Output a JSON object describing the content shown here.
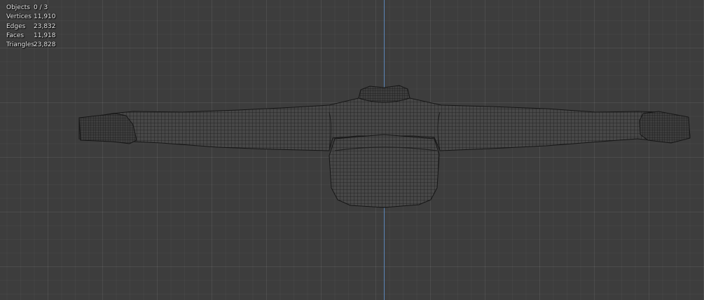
{
  "overlay_stats": [
    {
      "label": "Objects",
      "value": "0 / 3"
    },
    {
      "label": "Vertices",
      "value": "11,910"
    },
    {
      "label": "Edges",
      "value": "23,832"
    },
    {
      "label": "Faces",
      "value": "11,918"
    },
    {
      "label": "Triangles",
      "value": "23,828"
    }
  ],
  "colors": {
    "background": "#3d3d3d",
    "grid_line": "#4a4a4a",
    "z_axis": "#5b86b8",
    "mesh_fill": "#474747",
    "wire": "#1a1a1a",
    "text": "#e6e6e6"
  }
}
